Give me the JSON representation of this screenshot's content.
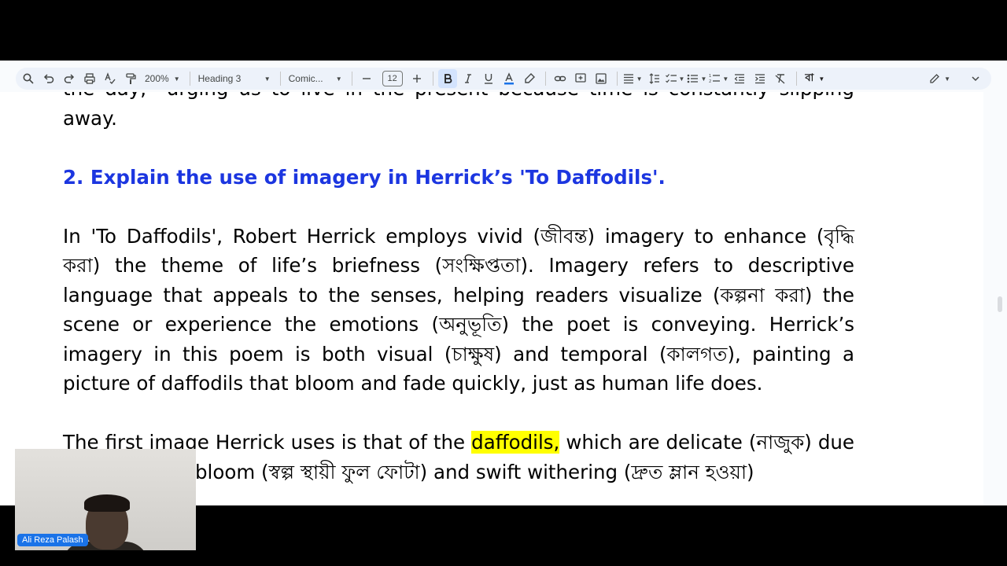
{
  "toolbar": {
    "zoom": "200%",
    "style": "Heading 3",
    "font": "Comic...",
    "font_size": "12",
    "input_tools": "বা",
    "icons": [
      "search-icon",
      "undo-icon",
      "redo-icon",
      "print-icon",
      "spellcheck-icon",
      "paint-format-icon",
      "bold-icon",
      "italic-icon",
      "underline-icon",
      "text-color-icon",
      "highlight-icon",
      "link-icon",
      "comment-icon",
      "image-icon",
      "align-icon",
      "line-spacing-icon",
      "checklist-icon",
      "bullet-list-icon",
      "numbered-list-icon",
      "decrease-indent-icon",
      "increase-indent-icon",
      "clear-format-icon",
      "edit-mode-icon",
      "collapse-icon"
    ],
    "accent": "#d3e3fd"
  },
  "doc": {
    "line_top": "the day,” urging us to live in the present because time is constantly slipping away.",
    "heading": "2. Explain the use of imagery in Herrick’s 'To Daffodils'.",
    "paragraph": "In 'To Daffodils', Robert Herrick employs vivid (জীবন্ত) imagery to enhance (বৃদ্ধি করা) the theme of life’s briefness (সংক্ষিপ্ততা). Imagery refers to descriptive language that appeals to the senses, helping readers visualize (কল্পনা করা) the scene or experience the emotions (অনুভূতি) the poet is conveying. Herrick’s imagery in this poem is both visual (চাক্ষুষ) and temporal (কালগত), painting a picture of daffodils that bloom and fade quickly, just as human life does.",
    "next_pre": "The first image Herrick uses is that of the ",
    "next_hl": "daffodils,",
    "next_post": " which are delicate (নাজুক) due to their short bloom (স্বল্প স্থায়ী ফুল ফোটা) and swift withering (দ্রুত ম্লান হওয়া)",
    "heading_color": "#1c36e0",
    "highlight_color": "#ffff00"
  },
  "camera": {
    "name": "Ali Reza Palash"
  }
}
